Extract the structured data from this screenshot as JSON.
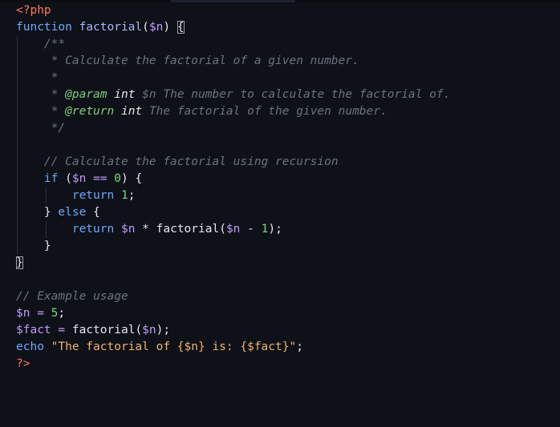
{
  "code": {
    "open_tag": "<?php",
    "close_tag": "?>",
    "kw_function": "function",
    "fn_name": "factorial",
    "param": "$n",
    "open_paren": "(",
    "close_paren": ")",
    "open_brace": "{",
    "close_brace": "}",
    "doc": {
      "start": "/**",
      "desc": "* Calculate the factorial of a given number.",
      "star": "*",
      "param_prefix": "* ",
      "param_tag": "@param",
      "param_type": "int",
      "param_var": "$n",
      "param_desc": "The number to calculate the factorial of.",
      "return_prefix": "* ",
      "return_tag": "@return",
      "return_type": "int",
      "return_desc": "The factorial of the given number.",
      "end": "*/"
    },
    "comment_recursion": "// Calculate the factorial using recursion",
    "kw_if": "if",
    "eq_op": "==",
    "zero": "0",
    "kw_return": "return",
    "one": "1",
    "kw_else": "else",
    "mul": "*",
    "minus": "-",
    "comment_usage": "// Example usage",
    "var_fact": "$fact",
    "assign": "=",
    "five": "5",
    "kw_echo": "echo",
    "string": "\"The factorial of {$n} is: {$fact}\""
  }
}
